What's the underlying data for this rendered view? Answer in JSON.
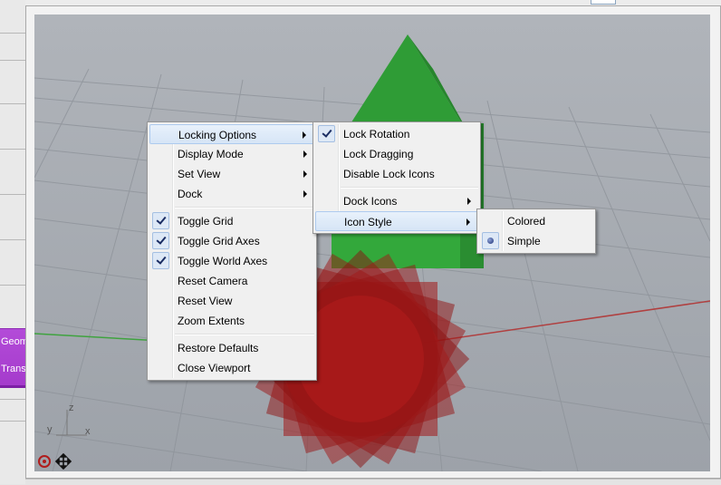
{
  "host": {
    "nodes": [
      {
        "label": "Geom"
      },
      {
        "label": "Trans"
      }
    ]
  },
  "context_menu": {
    "items": [
      {
        "label": "Locking Options",
        "submenu": true,
        "highlighted": true
      },
      {
        "label": "Display Mode",
        "submenu": true
      },
      {
        "label": "Set View",
        "submenu": true
      },
      {
        "label": "Dock",
        "submenu": true
      },
      {
        "label": "Toggle Grid",
        "checked": true
      },
      {
        "label": "Toggle Grid Axes",
        "checked": true
      },
      {
        "label": "Toggle World Axes",
        "checked": true
      },
      {
        "label": "Reset Camera"
      },
      {
        "label": "Reset View"
      },
      {
        "label": "Zoom Extents"
      },
      {
        "label": "Restore Defaults"
      },
      {
        "label": "Close Viewport"
      }
    ]
  },
  "locking_submenu": {
    "items": [
      {
        "label": "Lock Rotation",
        "checked": true
      },
      {
        "label": "Lock Dragging"
      },
      {
        "label": "Disable Lock Icons"
      },
      {
        "label": "Dock Icons",
        "submenu": true
      },
      {
        "label": "Icon Style",
        "submenu": true,
        "highlighted": true
      }
    ]
  },
  "icon_style_submenu": {
    "items": [
      {
        "label": "Colored"
      },
      {
        "label": "Simple",
        "selected": true
      }
    ]
  },
  "axes_gizmo": {
    "x": "x",
    "y": "y",
    "z": "z"
  },
  "colors": {
    "viewport_bg": "#a3a8af",
    "cone": "#2e9a36",
    "sphere": "#9a1414",
    "world_x_axis": "#b04040",
    "world_y_axis": "#3fa33f",
    "node_purple": "#a93fd0"
  },
  "icons": [
    "lock-reset-icon",
    "move-arrows-icon"
  ]
}
